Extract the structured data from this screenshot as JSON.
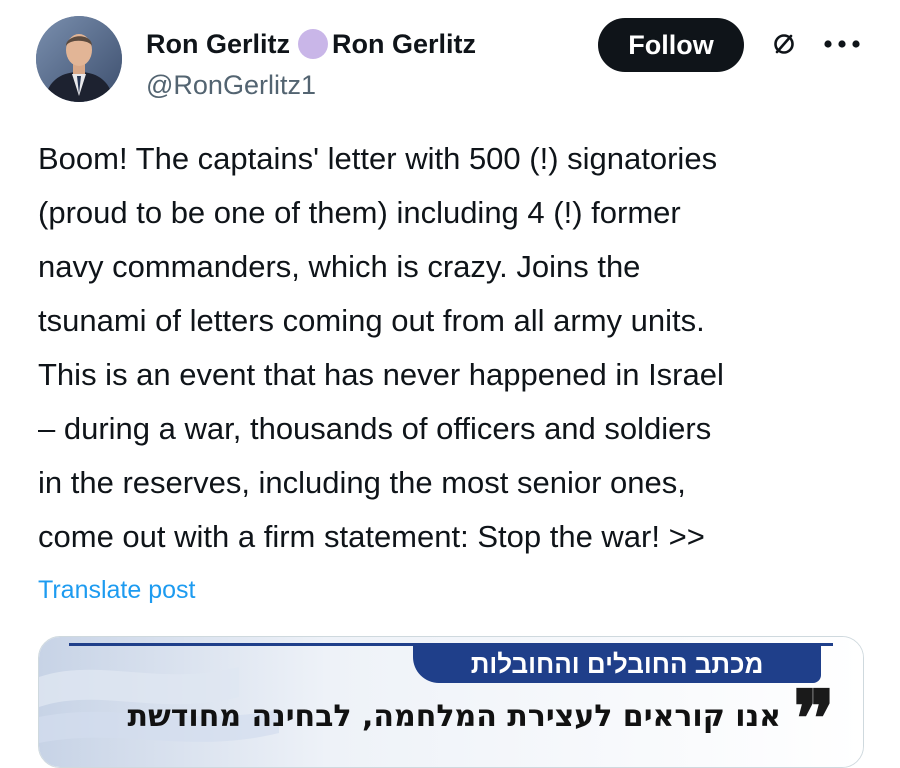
{
  "author": {
    "display_name": "Ron Gerlitz",
    "display_name_suffix": "Ron Gerlitz",
    "handle": "@RonGerlitz1",
    "avatar_icon": "profile-photo",
    "name_badge_color": "#c9b6e8"
  },
  "actions": {
    "follow_label": "Follow",
    "grok_icon": "slashed-circle-icon",
    "more_icon": "more-horizontal-icon"
  },
  "post": {
    "lines": [
      "Boom! The captains' letter with 500 (!) signatories",
      "(proud to be one of them) including 4 (!) former",
      "navy commanders, which is crazy. Joins the",
      "tsunami of letters coming out from all army units.",
      "This is an event that has never happened in Israel",
      "– during a war, thousands of officers and soldiers",
      "in the reserves, including the most senior ones,",
      "come out with a firm statement: Stop the war! >>"
    ],
    "translate_label": "Translate post"
  },
  "media": {
    "banner_text": "מכתב החובלים והחובלות",
    "headline_text": "אנו קוראים לעצירת המלחמה, לבחינה מחודשת",
    "quote_mark": "❞",
    "banner_color": "#1f3f8a"
  },
  "colors": {
    "text": "#0f1419",
    "secondary": "#536471",
    "link": "#1d9bf0",
    "button_bg": "#0f1419"
  }
}
